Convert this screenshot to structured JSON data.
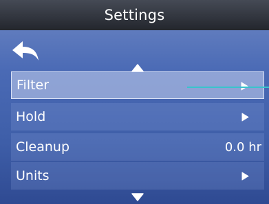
{
  "header": {
    "title": "Settings"
  },
  "navigation": {
    "back_icon": "back-arrow-icon",
    "scroll_up_icon": "scroll-up-icon",
    "scroll_down_icon": "scroll-down-icon"
  },
  "menu": {
    "items": [
      {
        "label": "Filter",
        "value": "",
        "chevron": true,
        "selected": true
      },
      {
        "label": "Hold",
        "value": "",
        "chevron": true,
        "selected": false
      },
      {
        "label": "Cleanup",
        "value": "0.0 hr",
        "chevron": false,
        "selected": false
      },
      {
        "label": "Units",
        "value": "",
        "chevron": true,
        "selected": false
      }
    ]
  },
  "colors": {
    "title_bar": "#2b2f37",
    "background_top": "#6f88c4",
    "background_bottom": "#2f4a92",
    "callout": "#38c4cc",
    "text": "#ffffff"
  }
}
